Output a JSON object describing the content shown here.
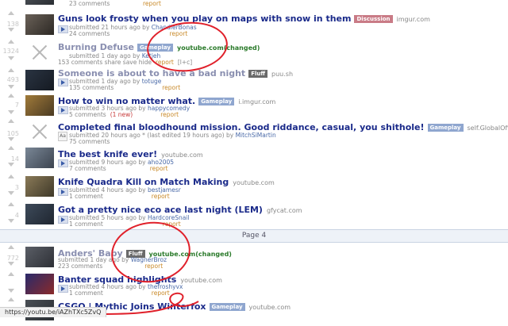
{
  "posts": [
    {
      "rank": "",
      "score": "",
      "title": "",
      "flair": "",
      "domain": "",
      "tagline": "",
      "user": "",
      "buttons": "23 comments",
      "report": "report"
    },
    {
      "rank": "138",
      "score": "",
      "title": "Guns look frosty when you play on maps with snow in them",
      "flair": "Discussion",
      "domain": "imgur.com",
      "tagline": "submitted 21 hours ago by",
      "user": "ChandlerBonas",
      "buttons": "24 comments",
      "report": "report"
    },
    {
      "rank": "1324",
      "score": "",
      "title": "Burning Defuse",
      "flair": "Gameplay",
      "domain": "youtube.com(changed)",
      "tagline": "submitted 1 day ago by",
      "user": "Ketjeh",
      "buttons": "153 comments  share  save  hide",
      "report": "report",
      "extra": "[l+c]"
    },
    {
      "rank": "493",
      "score": "",
      "title": "Someone is about to have a bad night",
      "flair": "Fluff",
      "domain": "puu.sh",
      "tagline": "submitted 1 day ago by",
      "user": "totuge",
      "buttons": "135 comments",
      "report": "report"
    },
    {
      "rank": "7",
      "score": "",
      "title": "How to win no matter what.",
      "flair": "Gameplay",
      "domain": "i.imgur.com",
      "tagline": "submitted 3 hours ago by",
      "user": "happycomedy",
      "buttons": "5 comments",
      "newc": "(1 new)",
      "report": "report"
    },
    {
      "rank": "105",
      "score": "",
      "title": "Completed final bloodhound mission. Good riddance, casual, you shithole!",
      "flair": "Gameplay",
      "domain": "self.GlobalOffensive",
      "tagline": "submitted 20 hours ago * (last edited 19 hours ago) by",
      "user": "MitchSiMartin",
      "buttons": "75 comments",
      "report": ""
    },
    {
      "rank": "14",
      "score": "",
      "title": "The best knife ever!",
      "flair": "",
      "domain": "youtube.com",
      "tagline": "submitted 9 hours ago by",
      "user": "aho2005",
      "buttons": "7 comments",
      "report": "report"
    },
    {
      "rank": "3",
      "score": "",
      "title": "Knife Quadra Kill on Match Making",
      "flair": "",
      "domain": "youtube.com",
      "tagline": "submitted 4 hours ago by",
      "user": "bestjamesr",
      "buttons": "1 comment",
      "report": "report"
    },
    {
      "rank": "4",
      "score": "",
      "title": "Got a pretty nice eco ace last night (LEM)",
      "flair": "",
      "domain": "gfycat.com",
      "tagline": "submitted 5 hours ago by",
      "user": "HardcoreSnail",
      "buttons": "1 comment",
      "report": "report"
    },
    {
      "rank": "772",
      "score": "",
      "title": "Anders' Baby",
      "flair": "Fluff",
      "domain": "youtube.com(changed)",
      "tagline": "submitted 1 day ago by",
      "user": "WagnerBroz",
      "buttons": "223 comments",
      "report": "report"
    },
    {
      "rank": "",
      "score": "",
      "title": "Banter squad highlights",
      "flair": "",
      "domain": "youtube.com",
      "tagline": "submitted 4 hours ago by",
      "user": "thefroshyvx",
      "buttons": "1 comment",
      "report": "report"
    },
    {
      "rank": "",
      "score": "",
      "title": "CSGO | Mythic Joins Winterfox",
      "flair": "Gameplay",
      "domain": "youtube.com",
      "tagline": "",
      "user": "",
      "buttons": "",
      "report": ""
    }
  ],
  "page_divider": "Page 4",
  "status_url": "https://youtu.be/iAZhTXc5ZvQ",
  "colors": {
    "highlight": "#e0212b",
    "title": "#1a2a8a",
    "domain_changed": "#2a7a2a"
  },
  "icons": [
    "upvote-icon",
    "downvote-icon",
    "thumbnail",
    "expando-icon",
    "no-thumbnail-icon",
    "self-post-icon"
  ]
}
